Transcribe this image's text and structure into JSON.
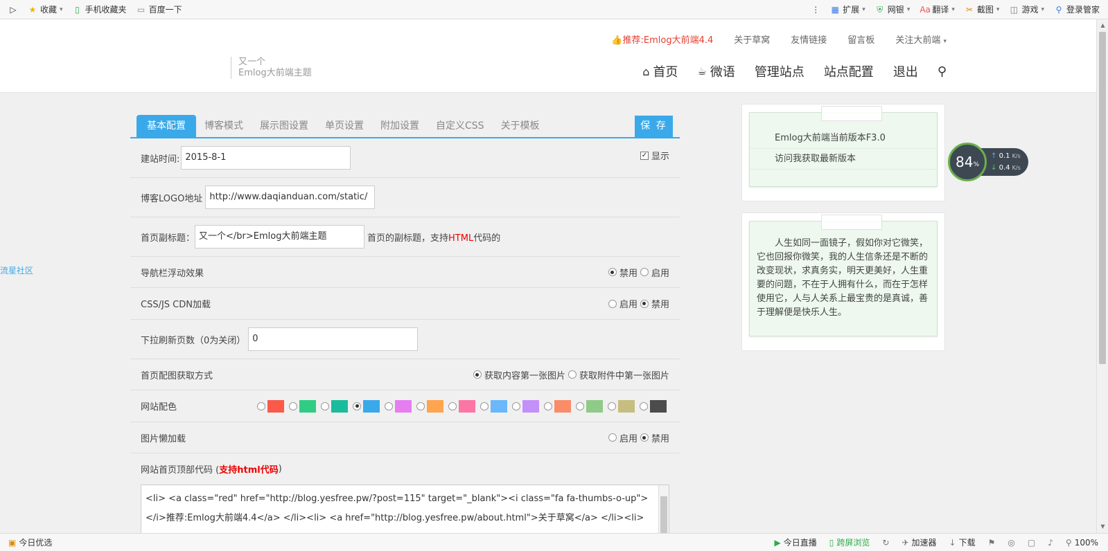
{
  "browser": {
    "left_items": [
      {
        "icon": "star-icon",
        "label": "收藏"
      },
      {
        "icon": "phone-icon",
        "label": "手机收藏夹"
      },
      {
        "icon": "page-icon",
        "label": "百度一下"
      }
    ],
    "right_items": [
      {
        "icon": "extension-icon",
        "label": "扩展"
      },
      {
        "icon": "shield-icon",
        "label": "网银"
      },
      {
        "icon": "translate-icon",
        "label": "翻译"
      },
      {
        "icon": "scissors-icon",
        "label": "截图"
      },
      {
        "icon": "gamepad-icon",
        "label": "游戏"
      },
      {
        "icon": "key-icon",
        "label": "登录管家"
      }
    ]
  },
  "status": {
    "left_label": "今日优选",
    "live": "今日直播",
    "cross_screen": "跨屏浏览",
    "accelerator": "加速器",
    "download": "下载",
    "zoom": "100%"
  },
  "header": {
    "topnav": [
      "推荐:Emlog大前端4.4",
      "关于草窝",
      "友情链接",
      "留言板",
      "关注大前端"
    ],
    "subtitle_line1": "又一个",
    "subtitle_line2": "Emlog大前端主题",
    "mainnav": [
      "首页",
      "微语",
      "管理站点",
      "站点配置",
      "退出"
    ]
  },
  "side_link": "流星社区",
  "tabs": [
    "基本配置",
    "博客模式",
    "展示图设置",
    "单页设置",
    "附加设置",
    "自定义CSS",
    "关于模板"
  ],
  "save_label": "保 存",
  "form": {
    "build_time_label": "建站时间:",
    "build_time_value": "2015-8-1",
    "show_label": "显示",
    "logo_label": "博客LOGO地址",
    "logo_value": "http://www.daqianduan.com/static/",
    "subtitle_label": "首页副标题：",
    "subtitle_value": "又一个</br>Emlog大前端主题",
    "subtitle_hint_pre": "首页的副标题，支持",
    "subtitle_hint_html": "HTML",
    "subtitle_hint_post": "代码的",
    "nav_float_label": "导航栏浮动效果",
    "cdn_label": "CSS/JS CDN加载",
    "pull_label": "下拉刷新页数（0为关闭）",
    "pull_value": "0",
    "thumb_label": "首页配图获取方式",
    "thumb_opt1": "获取内容第一张图片",
    "thumb_opt2": "获取附件中第一张图片",
    "color_label": "网站配色",
    "lazy_label": "图片懒加载",
    "disable": "禁用",
    "enable": "启用",
    "topcode_label_pre": "网站首页顶部代码 (",
    "topcode_label_em": "支持html代码",
    "topcode_label_post": ")",
    "topcode_line1": "<li> <a class=\"red\" href=\"http://blog.yesfree.pw/?post=115\" target=\"_blank\"><i class=\"fa fa-thumbs-o-up\">",
    "topcode_line2": "</i>推荐:Emlog大前端4.4</a> </li><li> <a href=\"http://blog.yesfree.pw/about.html\">关于草窝</a> </li><li>"
  },
  "palette": [
    "#f95a4a",
    "#2fcd84",
    "#1abc9c",
    "#3aa9e9",
    "#e57ff0",
    "#ffa44f",
    "#fb76a4",
    "#6ab8fa",
    "#c390f9",
    "#fb8c69",
    "#8fca89",
    "#c6be7f",
    "#4c4c4c"
  ],
  "palette_selected": 3,
  "widget1": {
    "line1": "Emlog大前端当前版本F3.0",
    "line2": "访问我获取最新版本"
  },
  "widget2": {
    "text": "人生如同一面镜子，假如你对它微笑，它也回报你微笑，我的人生信条还是不断的改变现状，求真务实，明天更美好，人生重要的问题，不在于人拥有什么，而在于怎样使用它，人与人关系上最宝贵的是真诚，善于理解便是快乐人生。"
  },
  "speed": {
    "percent": "84",
    "unit": "%",
    "up": "0.1",
    "down": "0.4",
    "rate_unit": "K/s"
  }
}
